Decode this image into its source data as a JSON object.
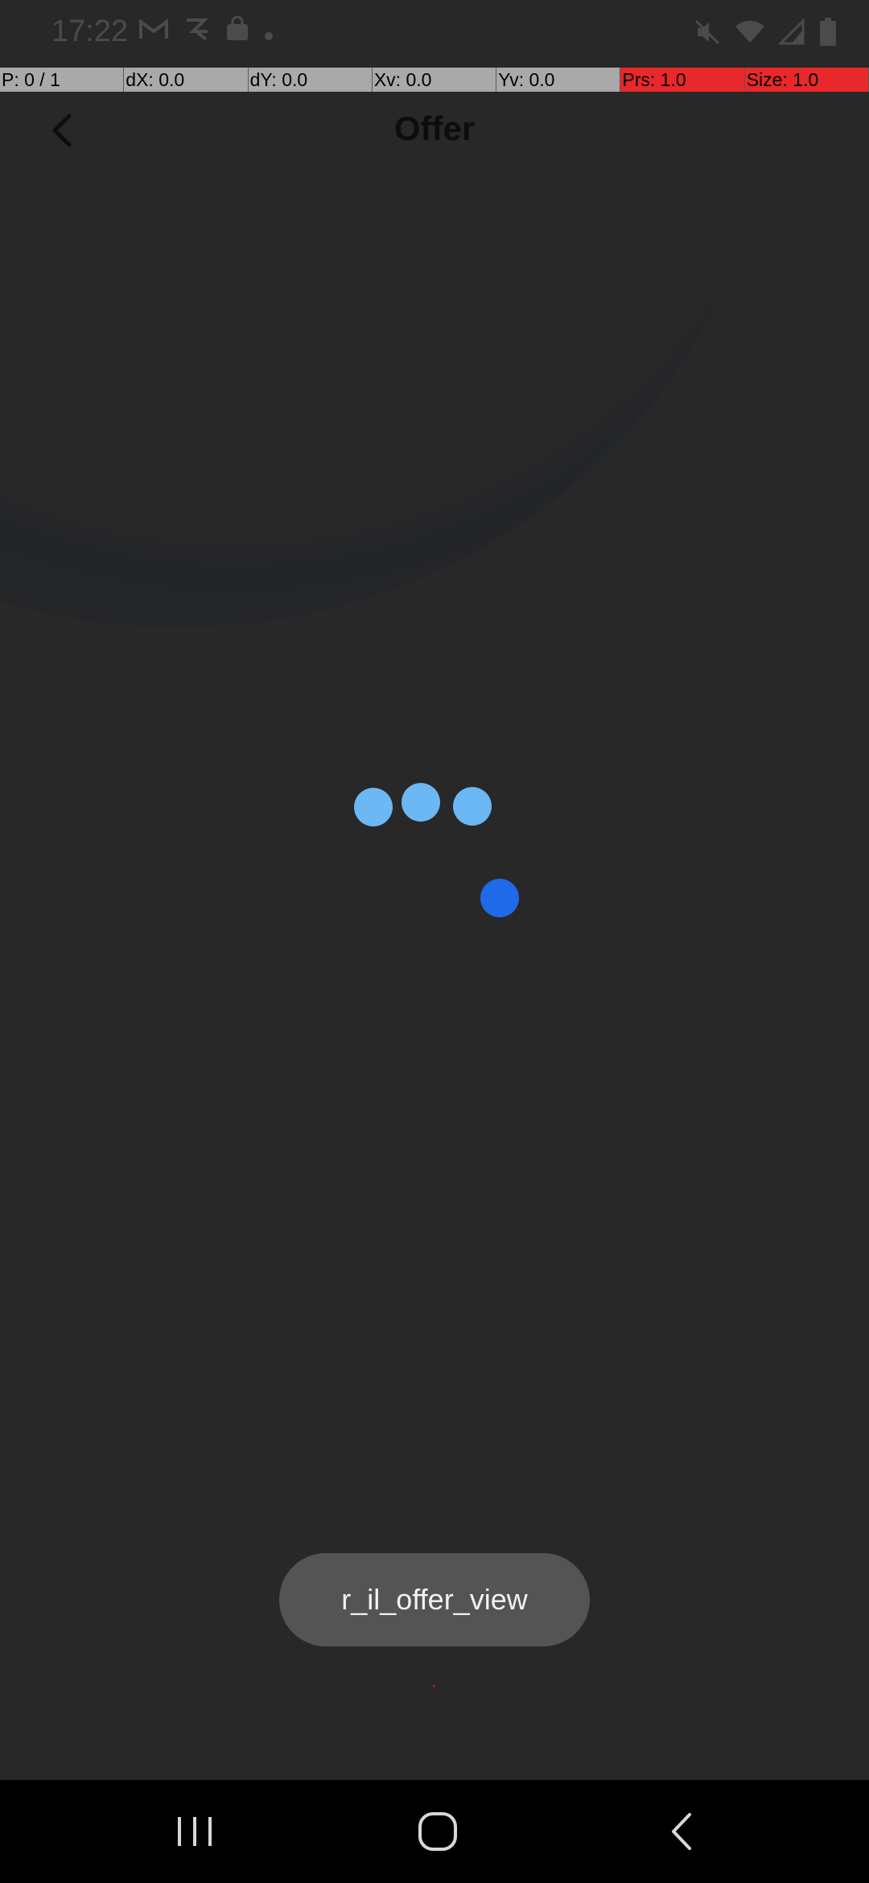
{
  "status_bar": {
    "time": "17:22",
    "left_icons": [
      "gmail-icon",
      "r-app-icon",
      "shopping-bag-icon",
      "dot-icon"
    ],
    "right_icons": [
      "mute-icon",
      "wifi-icon",
      "signal-icon",
      "battery-icon"
    ]
  },
  "pointer_overlay": {
    "cells": [
      {
        "label": "P: 0 / 1",
        "highlight": false
      },
      {
        "label": "dX: 0.0",
        "highlight": false
      },
      {
        "label": "dY: 0.0",
        "highlight": false
      },
      {
        "label": "Xv: 0.0",
        "highlight": false
      },
      {
        "label": "Yv: 0.0",
        "highlight": false
      },
      {
        "label": "Prs: 1.0",
        "highlight": true
      },
      {
        "label": "Size: 1.0",
        "highlight": true
      }
    ]
  },
  "toolbar": {
    "title": "Offer",
    "back_icon": "chevron-left-icon"
  },
  "loader": {
    "dot_color": "#6bb8f5",
    "accent_color": "#1f6ae8"
  },
  "toast": {
    "text": "r_il_offer_view"
  },
  "nav_bar": {
    "buttons": [
      "recents-icon",
      "home-icon",
      "back-icon"
    ]
  },
  "colors": {
    "background": "#282828",
    "pointer_bar_gray": "#a9a9a9",
    "pointer_bar_red": "#e8282b",
    "toast_bg": "#545454"
  }
}
